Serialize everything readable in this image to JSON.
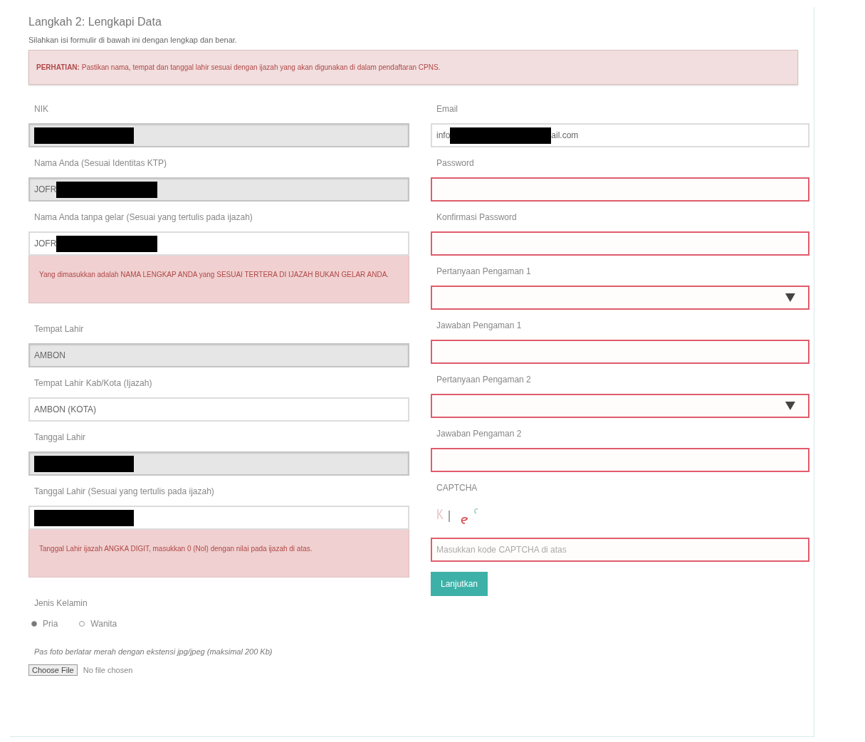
{
  "header": {
    "title": "Langkah 2: Lengkapi Data",
    "subtitle": "Silahkan isi formulir di bawah ini dengan lengkap dan benar.",
    "notice": "**PERHATIAN:** Pastikan nama, tempat dan tanggal lahir sesuai dengan ijazah yang akan digunakan di dalam pendaftaran CPNS."
  },
  "left_fields": [
    {
      "label": "NIK",
      "kind": "text",
      "disabled": true,
      "invalid": false,
      "redacted": true
    },
    {
      "label": "Nama Anda (Sesuai Identitas KTP)",
      "kind": "text",
      "disabled": true,
      "invalid": false,
      "value_prefix": "JOFR",
      "redacted": true
    },
    {
      "label": "Nama Anda tanpa gelar (Sesuai yang tertulis pada ijazah)",
      "kind": "text",
      "disabled": false,
      "invalid": false,
      "value_prefix": "JOFR",
      "redacted": true,
      "alert": "Yang dimasukkan adalah NAMA LENGKAP ANDA yang SESUAI TERTERA DI IJAZAH BUKAN GELAR ANDA."
    },
    {
      "label": "Tempat Lahir",
      "kind": "text",
      "disabled": true,
      "invalid": false,
      "value_prefix": "AMBON"
    },
    {
      "label": "Tempat Lahir Kab/Kota (Ijazah)",
      "kind": "text",
      "disabled": false,
      "invalid": false,
      "value_prefix": "AMBON (KOTA)"
    },
    {
      "label": "Tanggal Lahir",
      "kind": "text",
      "disabled": true,
      "invalid": false,
      "redacted": true
    },
    {
      "label": "Tanggal Lahir (Sesuai yang tertulis pada ijazah)",
      "kind": "text",
      "disabled": false,
      "invalid": false,
      "redacted": true,
      "alert": "Tanggal Lahir ijazah ANGKA DIGIT, masukkan 0 (Nol) dengan nilai pada ijazah di atas."
    }
  ],
  "gender": {
    "label": "Jenis Kelamin",
    "options": [
      {
        "label": "Pria",
        "selected": true
      },
      {
        "label": "Wanita",
        "selected": false
      }
    ]
  },
  "photo": {
    "hint": "Pas foto berlatar merah dengan ekstensi jpg/jpeg (maksimal 200 Kb)",
    "button": "Choose File",
    "status": "No file chosen"
  },
  "right_fields": [
    {
      "label": "Email",
      "kind": "text",
      "disabled": false,
      "invalid": false,
      "value_prefix": "info",
      "redacted": true,
      "value_suffix": "ail.com"
    },
    {
      "label": "Password",
      "kind": "text",
      "disabled": false,
      "invalid": true
    },
    {
      "label": "Konfirmasi Password",
      "kind": "text",
      "disabled": false,
      "invalid": true
    },
    {
      "label": "Pertanyaan Pengaman 1",
      "kind": "select",
      "disabled": false,
      "invalid": true
    },
    {
      "label": "Jawaban Pengaman 1",
      "kind": "text",
      "disabled": false,
      "invalid": true
    },
    {
      "label": "Pertanyaan Pengaman 2",
      "kind": "select",
      "disabled": false,
      "invalid": true
    },
    {
      "label": "Jawaban Pengaman 2",
      "kind": "text",
      "disabled": false,
      "invalid": true
    }
  ],
  "captcha": {
    "label": "CAPTCHA",
    "placeholder": "Masukkan kode CAPTCHA di atas",
    "invalid": true
  },
  "submit": "Lanjutkan"
}
